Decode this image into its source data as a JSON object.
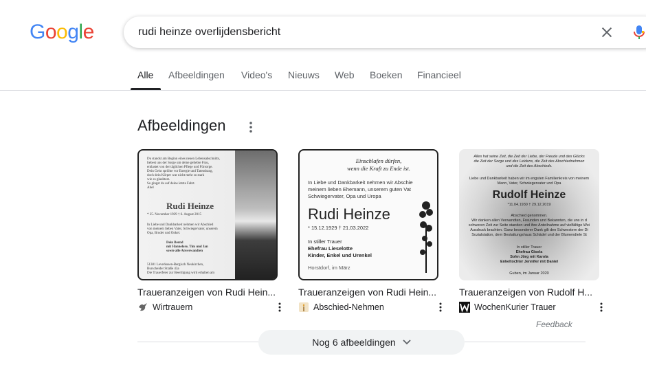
{
  "logo": {
    "letters": [
      {
        "char": "G",
        "color": "#4285f4"
      },
      {
        "char": "o",
        "color": "#ea4335"
      },
      {
        "char": "o",
        "color": "#fbbc05"
      },
      {
        "char": "g",
        "color": "#4285f4"
      },
      {
        "char": "l",
        "color": "#34a853"
      },
      {
        "char": "e",
        "color": "#ea4335"
      }
    ]
  },
  "search": {
    "query": "rudi heinze overlijdensbericht",
    "clear_icon": "close-icon",
    "mic_icon": "microphone-icon"
  },
  "tabs": [
    "Alle",
    "Afbeeldingen",
    "Video's",
    "Nieuws",
    "Web",
    "Boeken",
    "Financieel"
  ],
  "active_tab": "Alle",
  "images_section": {
    "title": "Afbeeldingen",
    "cards": [
      {
        "title": "Traueranzeigen von Rudi Hein...",
        "source": "Wirtrauern",
        "favicon": "dove-icon",
        "thumb": {
          "lines_top": [
            "Du standst am Beginn eines neuen Lebensabschnitts,",
            "liebest uns der Sorge um deine geliebte Frau,",
            "entlastet von der täglichen Pflege und Fürsorge.",
            "Dein Geist sprühte vor Energie und Tatendrang,",
            "doch dein Körper war nicht mehr so stark",
            "wie es glaubtest.",
            "So gingst du auf deine letzte Fahrt.",
            "Abel"
          ],
          "name": "Rudi Heinze",
          "dates": "* 25. November 1929     † 6. August 2015",
          "lines_mid": [
            "In Liebe und Dankbarkeit nehmen wir Abschied",
            "von meinem lieben Vater, Schwiegervater, unserem",
            "Opa, Bruder und Onkel."
          ],
          "family": [
            "Dein Bernd",
            "mit Hannelore, Tim und Jan",
            "sowie alle Anverwandten"
          ],
          "address": [
            "51381 Leverkusen-Bergisch Neukirchen,",
            "Burscheider Straße 43a",
            "Die Trauerfeier zur Beerdigung wird erhalten am"
          ]
        }
      },
      {
        "title": "Traueranzeigen von Rudi Hein...",
        "source": "Abschied-Nehmen",
        "favicon": "candle-icon",
        "thumb": {
          "head": [
            "Einschlafen dürfen,",
            "wenn die Kraft zu Ende ist."
          ],
          "body": [
            "In Liebe und Dankbarkeit nehmen wir Abschie",
            "meinem lieben Ehemann, unserem guten Vat",
            "Schwiegervater, Opa und Uropa"
          ],
          "name": "Rudi Heinze",
          "dates": "* 15.12.1929     † 21.03.2022",
          "mourn": [
            "In stiller Trauer",
            "Ehefrau Lieselotte",
            "Kinder, Enkel und Urenkel"
          ],
          "place": "Horstdorf, im März"
        }
      },
      {
        "title": "Traueranzeigen von Rudolf H...",
        "source": "WochenKurier Trauer",
        "favicon": "w-logo-icon",
        "thumb": {
          "top": [
            "Alles hat seine Zeit, die Zeit der Liebe, der Freude und des Glücks",
            "die Zeit der Sorge und des Leidens, die Zeit des Abschiednehmen",
            "und die Zeit des Abschieds."
          ],
          "intro": [
            "Liebe und Dankbarkeit haben wir im engsten Familienkreis von meinem",
            "Mann, Vater, Schwiegervater und Opa"
          ],
          "name": "Rudolf Heinze",
          "dates": "*11.04.1930          † 29.12.2019",
          "mid": [
            "Abschied genommen.",
            "Wir danken allen Verwandten, Freunden und Bekannten, die uns in d",
            "schweren Zeit zur Seite standen und ihre Anteilnahme auf vielfältige Wei",
            "Ausdruck brachten. Ganz besonderer Dank gilt den Schwestern der Di",
            "Sozialstation, dem Bestattungshaus Schädel und der Blumendiele St"
          ],
          "family": [
            "In stiller Trauer",
            "Ehefrau Gisela",
            "Sohn Jörg mit Karola",
            "Enkeltochter Jennifer mit Daniel"
          ],
          "place": "Guben, im Januar 2020"
        }
      }
    ],
    "feedback": "Feedback",
    "more_button": "Nog 6 afbeeldingen"
  }
}
